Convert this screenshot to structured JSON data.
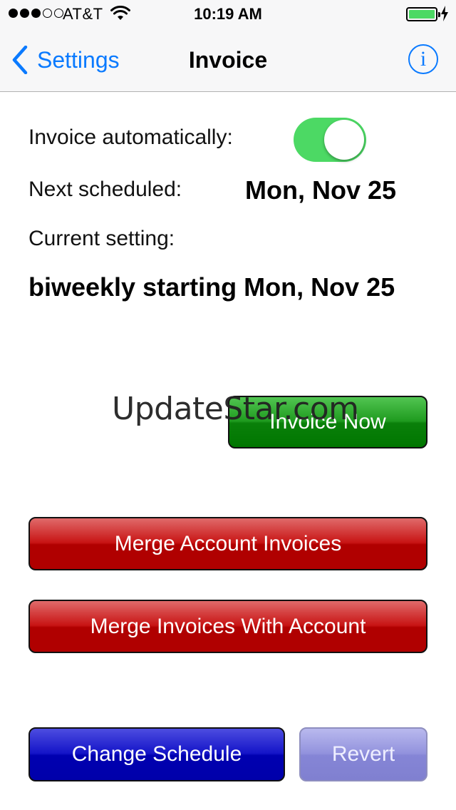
{
  "status_bar": {
    "carrier": "AT&T",
    "time": "10:19 AM",
    "signal_bars_filled": 3,
    "signal_bars_total": 5,
    "battery_color": "#4cd964"
  },
  "nav": {
    "back_label": "Settings",
    "title": "Invoice",
    "info_glyph": "i"
  },
  "settings": {
    "invoice_auto_label": "Invoice automatically:",
    "invoice_auto_on": true,
    "next_scheduled_label": "Next scheduled:",
    "next_scheduled_value": "Mon, Nov 25",
    "current_setting_label": "Current setting:",
    "current_setting_value": "biweekly starting Mon, Nov 25"
  },
  "actions": {
    "invoice_now": "Invoice Now",
    "merge_account_invoices": "Merge Account Invoices",
    "merge_invoices_with_account": "Merge Invoices With Account",
    "change_schedule": "Change Schedule",
    "revert": "Revert"
  },
  "watermark": "UpdateStar.com",
  "colors": {
    "accent_blue": "#0a7aff",
    "toggle_on": "#4cd964",
    "green_button": "#007600",
    "red_button": "#b00000",
    "blue_button": "#0000b0",
    "revert_button": "#8585d6"
  }
}
